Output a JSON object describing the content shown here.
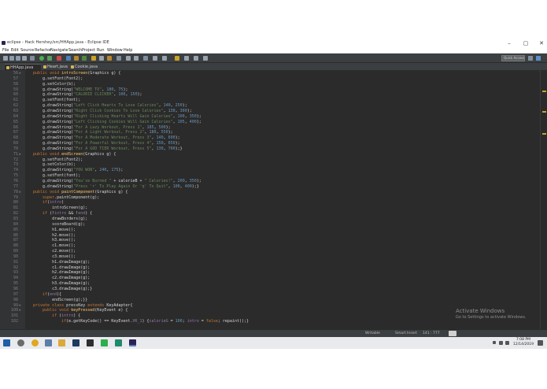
{
  "window": {
    "title": "eclipse - Hack Hershey/src/HHApp.java - Eclipse IDE",
    "controls": [
      "–",
      "▢",
      "✕"
    ]
  },
  "menu": [
    "File",
    "Edit",
    "Source",
    "Refactor",
    "Navigate",
    "Search",
    "Project",
    "Run",
    "Window",
    "Help"
  ],
  "toolbar": {
    "quick_access": "Quick Access"
  },
  "tabs": [
    {
      "label": "HHApp.java",
      "active": true
    },
    {
      "label": "Heart.java",
      "active": false
    },
    {
      "label": "Cookie.java",
      "active": false
    }
  ],
  "editor": {
    "lines": [
      {
        "n": "56",
        "fold": "⊖",
        "html": "<span class=\"k\">public void</span> <span class=\"m\">introScreen</span>(Graphics g) {"
      },
      {
        "n": "57",
        "html": "    g.setFont(Font2);"
      },
      {
        "n": "58",
        "html": "    g.setColor(b);"
      },
      {
        "n": "59",
        "html": "    g.drawString(<span class=\"s\">\"WELCOME TO\"</span>, <span class=\"n\">180</span>, <span class=\"n\">75</span>);"
      },
      {
        "n": "60",
        "html": "    g.drawString(<span class=\"s\">\"CALORIE CLICKER\"</span>, <span class=\"n\">100</span>, <span class=\"n\">150</span>);"
      },
      {
        "n": "61",
        "html": "    g.setFont(font);"
      },
      {
        "n": "62",
        "html": "    g.drawString(<span class=\"s\">\"Left Click Hearts To Lose Calories\"</span>, <span class=\"n\">140</span>, <span class=\"n\">250</span>);"
      },
      {
        "n": "63",
        "html": "    g.drawString(<span class=\"s\">\"Right Click Cookies To Lose Calories\"</span>, <span class=\"n\">130</span>, <span class=\"n\">300</span>);"
      },
      {
        "n": "64",
        "html": "    g.drawString(<span class=\"s\">\"Right Clicking Hearts Will Gain Calories\"</span>, <span class=\"n\">100</span>, <span class=\"n\">350</span>);"
      },
      {
        "n": "65",
        "html": "    g.drawString(<span class=\"s\">\"Left Clicking Cookies Will Gain Calories\"</span>, <span class=\"n\">105</span>, <span class=\"n\">400</span>);"
      },
      {
        "n": "66",
        "html": "    g.drawString(<span class=\"s\">\"For A Lazy Workout, Press 1\"</span>, <span class=\"n\">185</span>, <span class=\"n\">500</span>);"
      },
      {
        "n": "67",
        "html": "    g.drawString(<span class=\"s\">\"For A Light Workout, Press 2\"</span>, <span class=\"n\">180</span>, <span class=\"n\">550</span>);"
      },
      {
        "n": "68",
        "html": "    g.drawString(<span class=\"s\">\"For A Moderate Workout, Press 3\"</span>, <span class=\"n\">140</span>, <span class=\"n\">600</span>);"
      },
      {
        "n": "69",
        "html": "    g.drawString(<span class=\"s\">\"For A Powerful Workout, Press 4\"</span>, <span class=\"n\">150</span>, <span class=\"n\">650</span>);"
      },
      {
        "n": "70",
        "html": "    g.drawString(<span class=\"s\">\"For A GOD TIER Workout, Press 5\"</span>, <span class=\"n\">130</span>, <span class=\"n\">700</span>);}"
      },
      {
        "n": "71",
        "fold": "⊖",
        "html": "<span class=\"k\">public void</span> <span class=\"m\">endScreen</span>(Graphics g) {"
      },
      {
        "n": "72",
        "html": "    g.setFont(Font2);"
      },
      {
        "n": "73",
        "html": "    g.setColor(b);"
      },
      {
        "n": "74",
        "html": "    g.drawString(<span class=\"s\">\"YOU WON\"</span>, <span class=\"n\">240</span>, <span class=\"n\">175</span>);"
      },
      {
        "n": "75",
        "html": "    g.setFont(font);"
      },
      {
        "n": "76",
        "html": "    g.drawString(<span class=\"s\">\"You've Burned \"</span> + calorieB + <span class=\"s\">\" Calories!\"</span>, <span class=\"n\">200</span>, <span class=\"n\">350</span>);"
      },
      {
        "n": "77",
        "html": "    g.drawString(<span class=\"s\">\"Press 'r' To Play Again Or 'q' To Quit\"</span>, <span class=\"n\">100</span>, <span class=\"n\">400</span>);}"
      },
      {
        "n": "78",
        "fold": "⊖",
        "html": "<span class=\"k\">public void</span> <span class=\"m\">paintComponent</span>(Graphics g) {"
      },
      {
        "n": "79",
        "html": "    <span class=\"k\">super</span>.paintComponent(g);"
      },
      {
        "n": "80",
        "html": "    <span class=\"k\">if</span>(<span class=\"f\">intro</span>)"
      },
      {
        "n": "81",
        "html": "        introScreen(g);"
      },
      {
        "n": "82",
        "html": "    <span class=\"k\">if</span> (!<span class=\"f\">intro</span> &amp;&amp; !<span class=\"f\">end</span>) {"
      },
      {
        "n": "83",
        "html": "        drawBorders(g);"
      },
      {
        "n": "84",
        "html": "        scoreBoard(g);"
      },
      {
        "n": "85",
        "html": "        h1.move();"
      },
      {
        "n": "86",
        "html": "        h2.move();"
      },
      {
        "n": "87",
        "html": "        h3.move();"
      },
      {
        "n": "88",
        "html": "        c1.move();"
      },
      {
        "n": "89",
        "html": "        c2.move();"
      },
      {
        "n": "90",
        "html": "        c3.move();"
      },
      {
        "n": "91",
        "html": "        h1.drawImage(g);"
      },
      {
        "n": "92",
        "html": "        c1.drawImage(g);"
      },
      {
        "n": "93",
        "html": "        h2.drawImage(g);"
      },
      {
        "n": "94",
        "html": "        c2.drawImage(g);"
      },
      {
        "n": "95",
        "html": "        h3.drawImage(g);"
      },
      {
        "n": "96",
        "html": "        c3.drawImage(g);}"
      },
      {
        "n": "97",
        "html": "    <span class=\"k\">if</span>(<span class=\"f\">end</span>){"
      },
      {
        "n": "98",
        "html": "        endScreen(g);}}"
      },
      {
        "n": "99",
        "fold": "⊖",
        "html": "<span class=\"k\">private class</span> pressKey <span class=\"k\">extends</span> KeyAdapter{"
      },
      {
        "n": "100",
        "fold": "⊖",
        "html": "    <span class=\"k\">public void</span> <span class=\"m\">keyPressed</span>(KeyEvent e) {"
      },
      {
        "n": "101",
        "html": "        <span class=\"k\">if</span> (<span class=\"f\">intro</span>) {"
      },
      {
        "n": "102",
        "html": "            <span class=\"k\">if</span>(e.getKeyCode() == KeyEvent.<span class=\"f\">VK_1</span>) {<span class=\"f\">calorieG</span> = <span class=\"n\">100</span>; <span class=\"f\">intro</span> = <span class=\"k\">false</span>; repaint();}"
      }
    ]
  },
  "watermark": {
    "title": "Activate Windows",
    "subtitle": "Go to Settings to activate Windows."
  },
  "status": {
    "writable": "Writable",
    "insert_mode": "Smart Insert",
    "position": "141 : 777"
  },
  "taskbar": {
    "time": "7:08 PM",
    "date": "12/14/2019"
  },
  "colors": {
    "editor_bg": "#2b2b2b",
    "keyword": "#cc7832",
    "string": "#6a8759",
    "method": "#ffc66d",
    "number": "#6897bb",
    "field": "#9876aa"
  }
}
